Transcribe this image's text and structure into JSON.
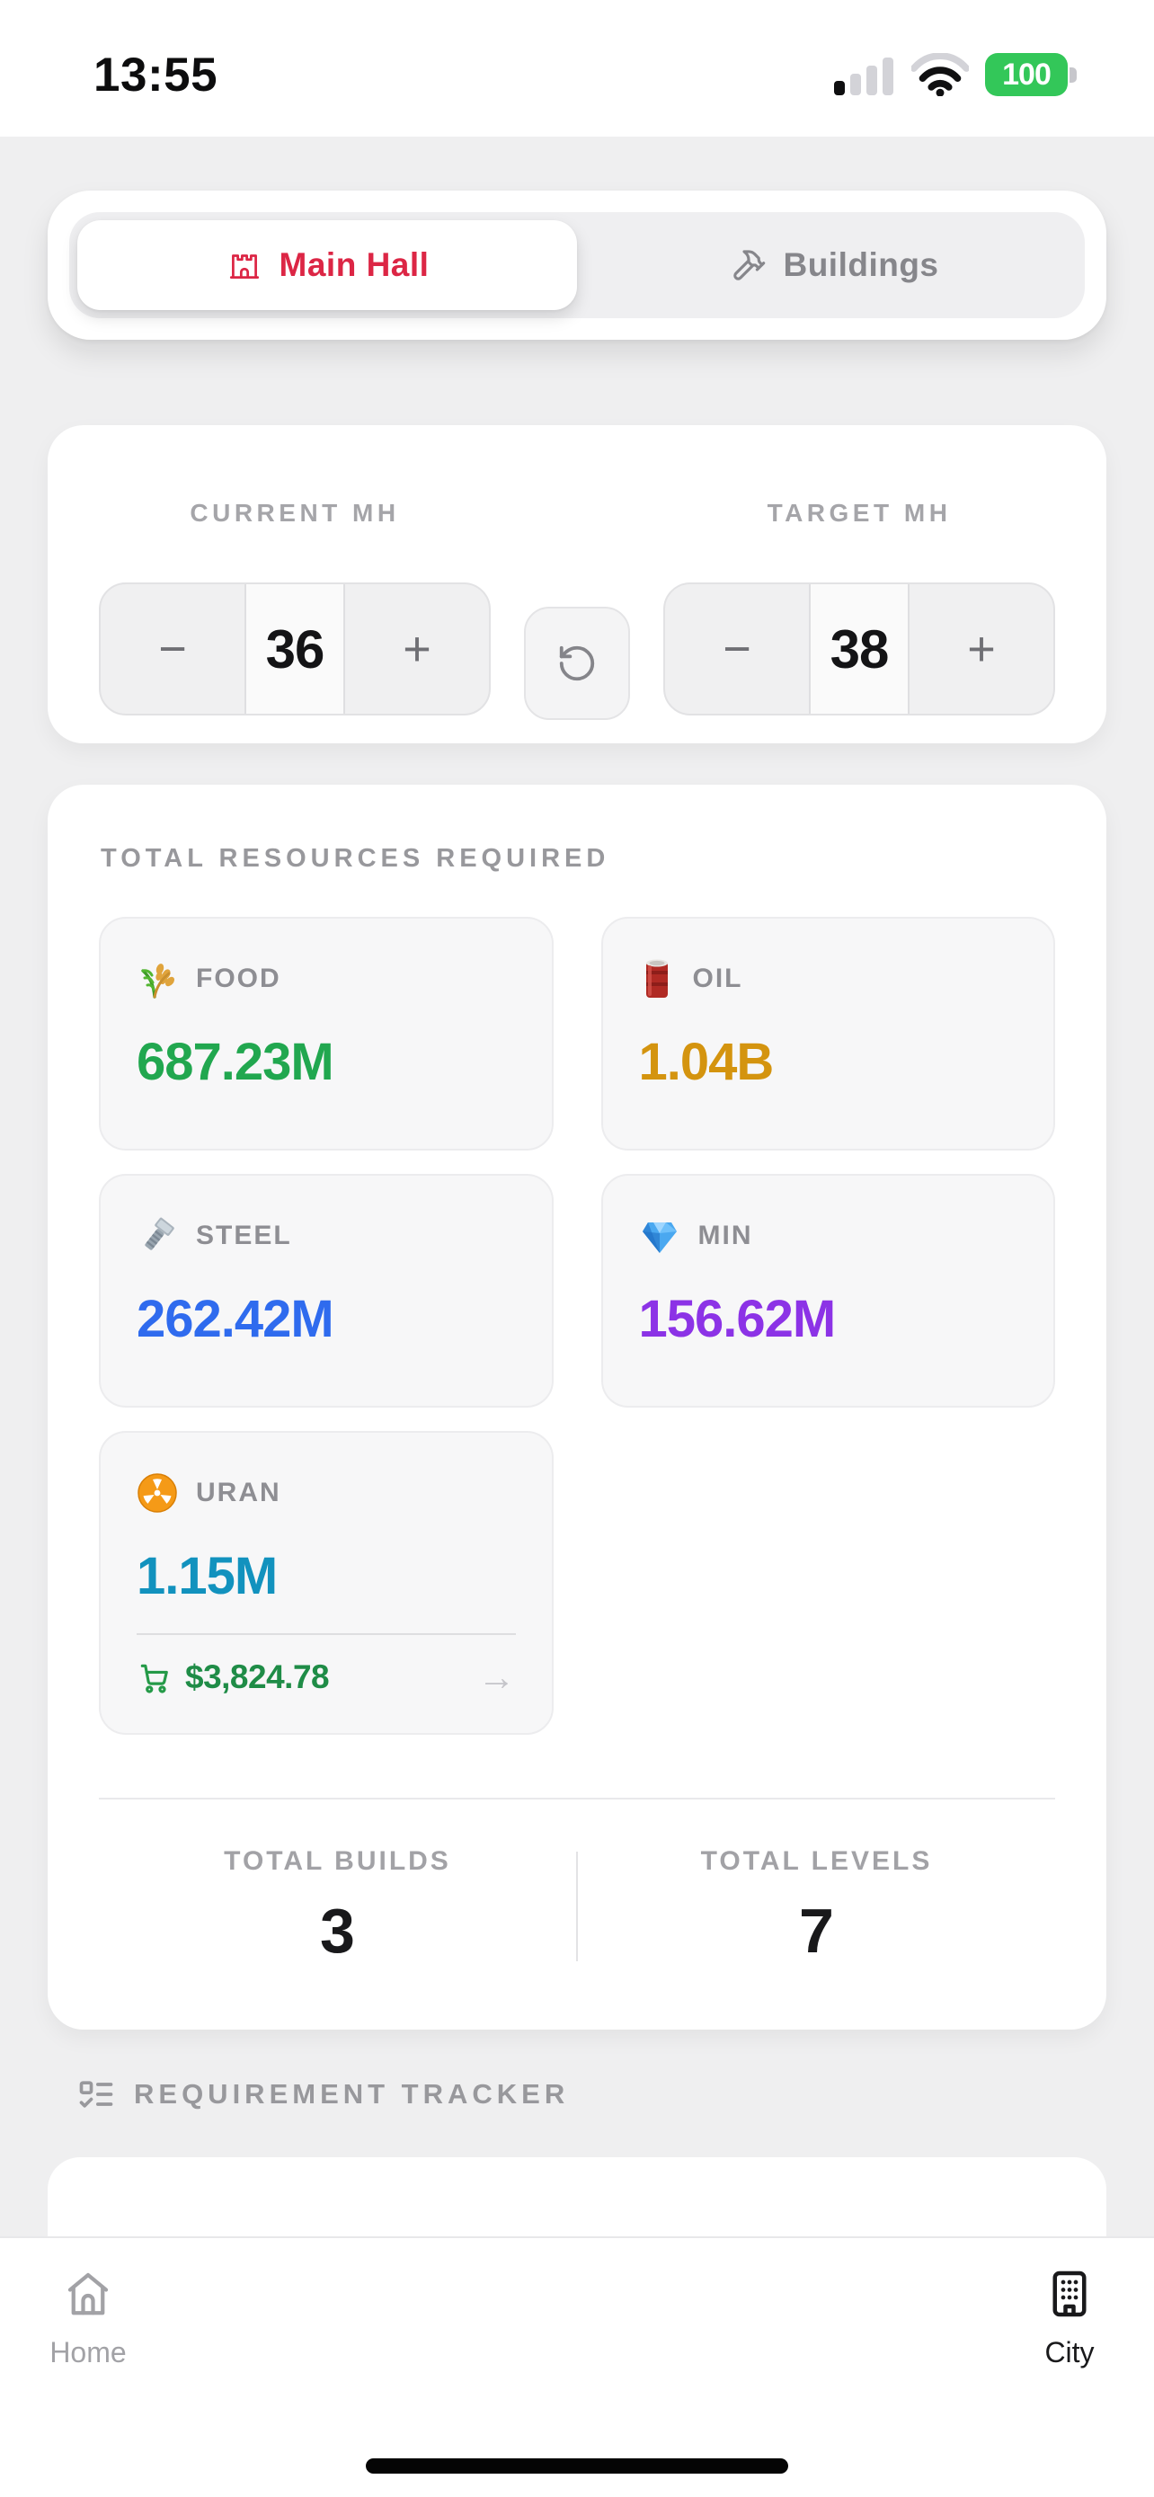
{
  "status_bar": {
    "time": "13:55",
    "battery_level": "100"
  },
  "tab_bar": {
    "main_hall_label": "Main Hall",
    "buildings_label": "Buildings"
  },
  "selector": {
    "current_label": "CURRENT MH",
    "current_value": "36",
    "target_label": "TARGET MH",
    "target_value": "38",
    "minus": "−",
    "plus": "+"
  },
  "resources": {
    "title": "TOTAL RESOURCES REQUIRED",
    "items": [
      {
        "label": "FOOD",
        "value": "687.23M",
        "color": "#21a74f",
        "icon": "rice-plant-icon"
      },
      {
        "label": "OIL",
        "value": "1.04B",
        "color": "#d4940f",
        "icon": "oil-barrel-icon"
      },
      {
        "label": "STEEL",
        "value": "262.42M",
        "color": "#2f6bee",
        "icon": "bolt-icon"
      },
      {
        "label": "MIN",
        "value": "156.62M",
        "color": "#8c33e6",
        "icon": "gem-icon"
      },
      {
        "label": "URAN",
        "value": "1.15M",
        "color": "#1292be",
        "icon": "radioactive-icon"
      }
    ],
    "uran_price": "$3,824.78",
    "arrow": "→"
  },
  "totals": {
    "builds_label": "TOTAL BUILDS",
    "builds_value": "3",
    "levels_label": "TOTAL LEVELS",
    "levels_value": "7"
  },
  "tracker": {
    "title": "REQUIREMENT TRACKER"
  },
  "bottom_nav": {
    "home_label": "Home",
    "city_label": "City"
  },
  "colors": {
    "accent_red": "#dc2645",
    "price_green": "#1f8c47",
    "battery_green": "#33c759"
  }
}
